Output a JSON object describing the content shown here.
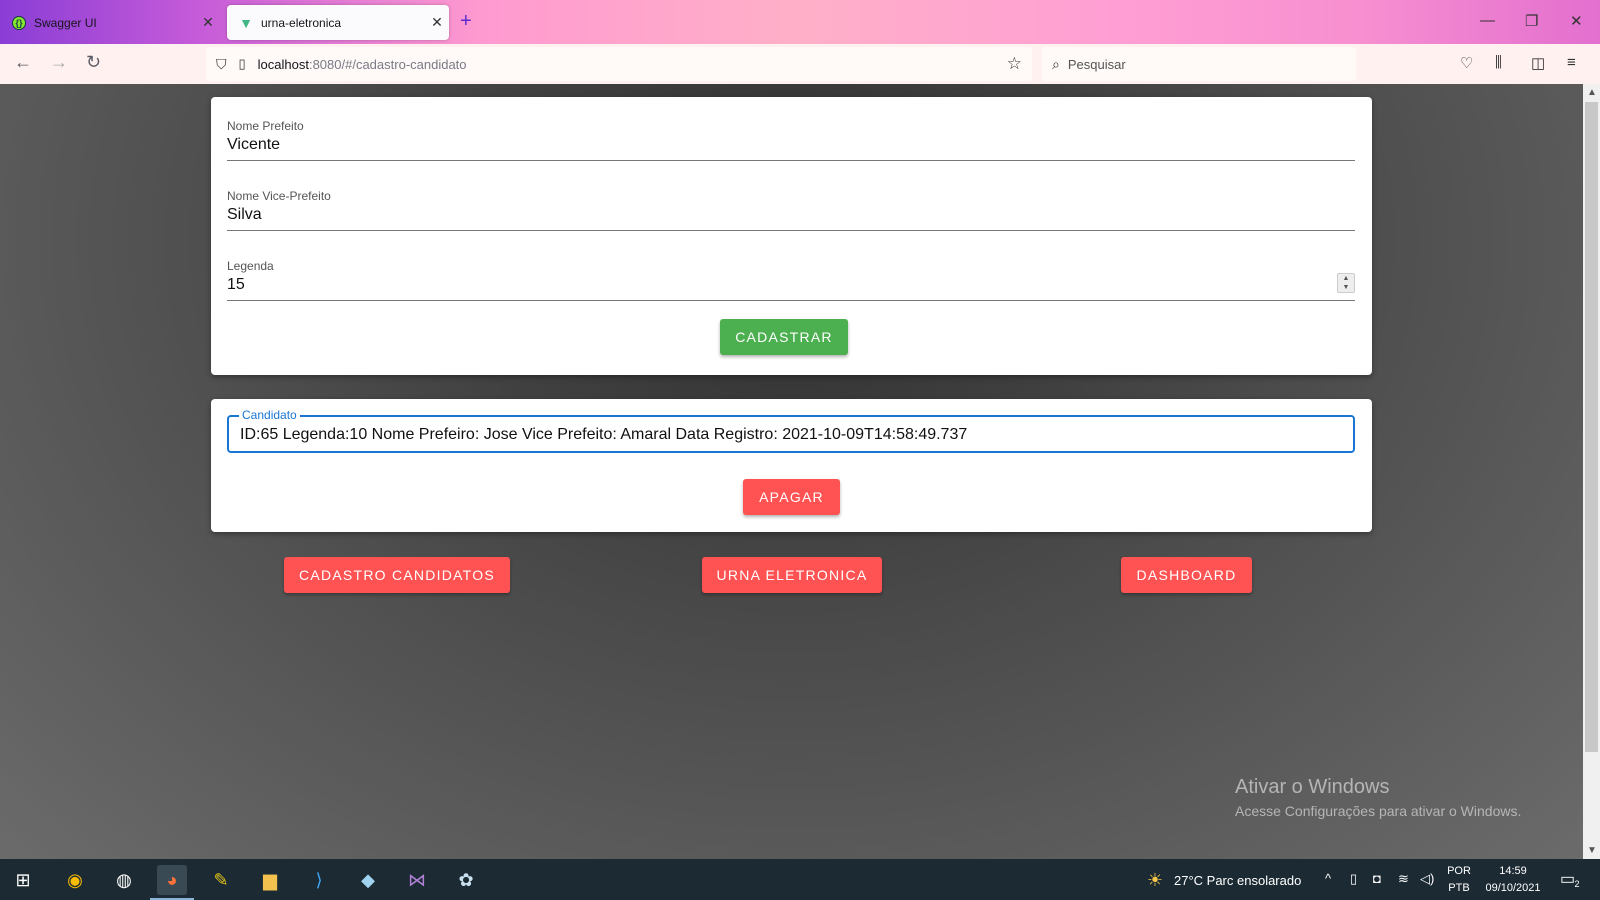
{
  "browser": {
    "tabs": [
      {
        "title": "Swagger UI",
        "active": false
      },
      {
        "title": "urna-eletronica",
        "active": true
      }
    ],
    "url_host": "localhost",
    "url_path": ":8080/#/cadastro-candidato",
    "search_placeholder": "Pesquisar"
  },
  "form": {
    "prefeito_label": "Nome Prefeito",
    "prefeito_value": "Vicente",
    "vice_label": "Nome Vice-Prefeito",
    "vice_value": "Silva",
    "legenda_label": "Legenda",
    "legenda_value": "15",
    "submit_label": "CADASTRAR"
  },
  "candidate_select": {
    "label": "Candidato",
    "value": "ID:65 Legenda:10 Nome Prefeiro: Jose Vice Prefeito: Amaral Data Registro: 2021-10-09T14:58:49.737",
    "delete_label": "APAGAR"
  },
  "nav_buttons": {
    "cadastro": "CADASTRO CANDIDATOS",
    "urna": "URNA ELETRONICA",
    "dashboard": "DASHBOARD"
  },
  "colors": {
    "success": "#4caf50",
    "error": "#ff5252",
    "focus": "#1976d2"
  },
  "watermark": {
    "title": "Ativar o Windows",
    "subtitle": "Acesse Configurações para ativar o Windows."
  },
  "taskbar": {
    "weather": "27°C  Parc ensolarado",
    "lang_top": "POR",
    "lang_bottom": "PTB",
    "time": "14:59",
    "date": "09/10/2021",
    "notifications": "2"
  }
}
